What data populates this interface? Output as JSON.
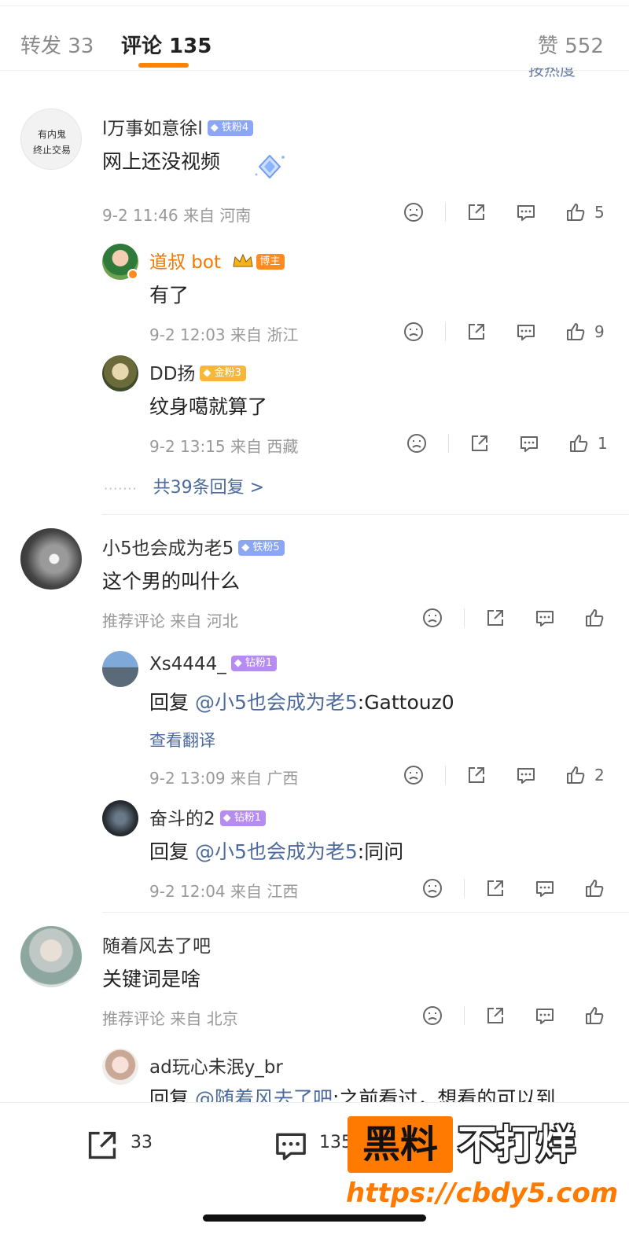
{
  "tabs": {
    "repost": "转发 33",
    "comments": "评论 135",
    "likes": "赞 552",
    "sort_label": "按热度"
  },
  "comments": [
    {
      "avatar_text": [
        "有内鬼",
        "终止交易"
      ],
      "name": "l万事如意徐l",
      "badge": "铁粉4",
      "text": "网上还没视频",
      "meta": "9-2 11:46 来自 河南",
      "likes": "5",
      "replies": [
        {
          "name": "道叔 bot",
          "badge": "博主",
          "text": "有了",
          "meta": "9-2 12:03 来自 浙江",
          "likes": "9"
        },
        {
          "name": "DD扬",
          "badge": "金粉3",
          "text": "纹身噶就算了",
          "meta": "9-2 13:15 来自 西藏",
          "likes": "1"
        }
      ],
      "more_replies": "共39条回复 >"
    },
    {
      "name": "小5也会成为老5",
      "badge": "铁粉5",
      "text": "这个男的叫什么",
      "meta": "推荐评论  来自 河北",
      "likes": "",
      "replies": [
        {
          "name": "Xs4444_",
          "badge": "钻粉1",
          "reply_prefix": "回复 ",
          "mention": "@小5也会成为老5",
          "reply_text": ":Gattouz0",
          "translate": "查看翻译",
          "meta": "9-2 13:09 来自 广西",
          "likes": "2"
        },
        {
          "name": "奋斗的2",
          "badge": "钻粉1",
          "reply_prefix": "回复 ",
          "mention": "@小5也会成为老5",
          "reply_text": ":同问",
          "meta": "9-2 12:04 来自 江西",
          "likes": ""
        }
      ]
    },
    {
      "name": "随着风去了吧",
      "text": "关键词是啥",
      "meta": "推荐评论  来自 北京",
      "likes": "",
      "replies": [
        {
          "name": "ad玩心未泯y_br",
          "reply_prefix": "回复 ",
          "mention": "@随着风去了吧",
          "reply_text": ":之前看过，想看的可以到"
        }
      ]
    }
  ],
  "bottom_bar": {
    "repost_count": "33",
    "comment_count": "135"
  },
  "watermark": {
    "box": "黑料",
    "text": "不打烊",
    "url": "https://cbdy5.com"
  },
  "colors": {
    "accent": "#ff8200",
    "link": "#4c6a9c"
  }
}
